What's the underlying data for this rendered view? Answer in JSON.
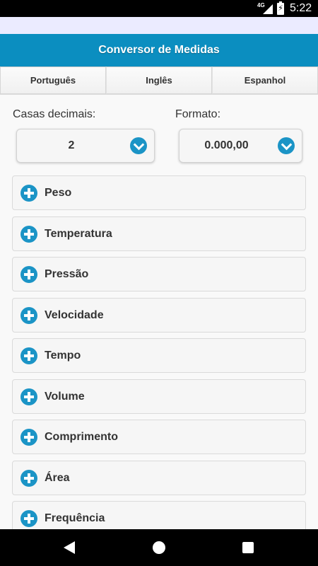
{
  "status_bar": {
    "network": "4G",
    "battery_glyph": "⚡",
    "time": "5:22"
  },
  "header": {
    "title": "Conversor de Medidas"
  },
  "tabs": [
    {
      "label": "Português"
    },
    {
      "label": "Inglês"
    },
    {
      "label": "Espanhol"
    }
  ],
  "settings": {
    "decimals": {
      "label": "Casas decimais:",
      "value": "2"
    },
    "format": {
      "label": "Formato:",
      "value": "0.000,00"
    }
  },
  "categories": [
    {
      "label": "Peso",
      "icon": "plus-circle-icon"
    },
    {
      "label": "Temperatura",
      "icon": "plus-circle-icon"
    },
    {
      "label": "Pressão",
      "icon": "plus-circle-icon"
    },
    {
      "label": "Velocidade",
      "icon": "plus-circle-icon"
    },
    {
      "label": "Tempo",
      "icon": "plus-circle-icon"
    },
    {
      "label": "Volume",
      "icon": "plus-circle-icon"
    },
    {
      "label": "Comprimento",
      "icon": "plus-circle-icon"
    },
    {
      "label": "Área",
      "icon": "plus-circle-icon"
    },
    {
      "label": "Frequência",
      "icon": "plus-circle-icon"
    }
  ],
  "colors": {
    "accent": "#0b8ec0",
    "icon": "#1b94c6"
  }
}
